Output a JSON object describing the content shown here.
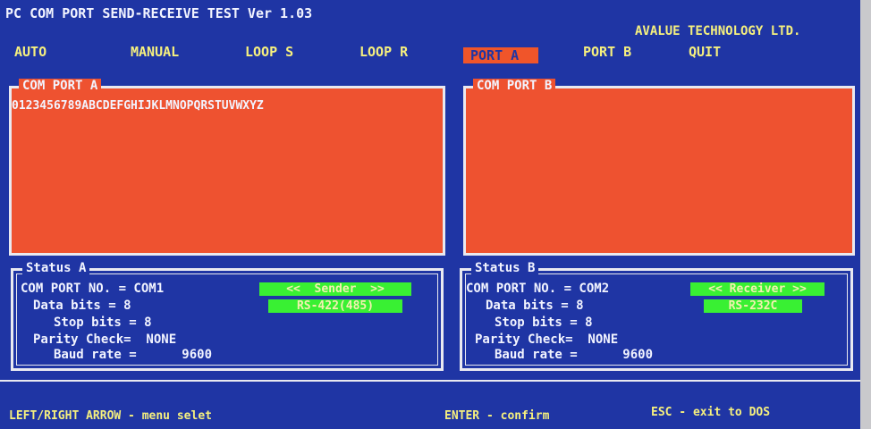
{
  "app": {
    "title": "PC COM PORT SEND-RECEIVE TEST Ver 1.03",
    "company": "AVALUE TECHNOLOGY LTD."
  },
  "menu": {
    "items": [
      {
        "label": "AUTO"
      },
      {
        "label": "MANUAL"
      },
      {
        "label": "LOOP S"
      },
      {
        "label": "LOOP R"
      },
      {
        "label": "PORT A",
        "selected": true
      },
      {
        "label": "PORT B"
      },
      {
        "label": "QUIT"
      }
    ]
  },
  "port_a": {
    "title": "COM PORT A",
    "content": "0123456789ABCDEFGHIJKLMNOPQRSTUVWXYZ"
  },
  "port_b": {
    "title": "COM PORT B",
    "content": ""
  },
  "status_a": {
    "title": "Status A",
    "com_port": "COM PORT NO. = COM1",
    "data_bits": "Data bits = 8",
    "stop_bits": "Stop bits = 8",
    "parity": "Parity Check=  NONE",
    "baud": "Baud rate =      9600",
    "role": "<<  Sender  >>",
    "mode": "RS-422(485)"
  },
  "status_b": {
    "title": "Status B",
    "com_port": "COM PORT NO. = COM2",
    "data_bits": "Data bits = 8",
    "stop_bits": "Stop bits = 8",
    "parity": "Parity Check=  NONE",
    "baud": "Baud rate =      9600",
    "role": "<< Receiver >>",
    "mode": "RS-232C"
  },
  "footer": {
    "hint_arrows": "LEFT/RIGHT ARROW - menu selet",
    "hint_enter": "ENTER - confirm",
    "hint_esc": "ESC - exit to DOS"
  },
  "colors": {
    "background": "#1f35a4",
    "panel": "#ee5230",
    "text_yellow": "#f6f07e",
    "highlight_green": "#39f033"
  }
}
